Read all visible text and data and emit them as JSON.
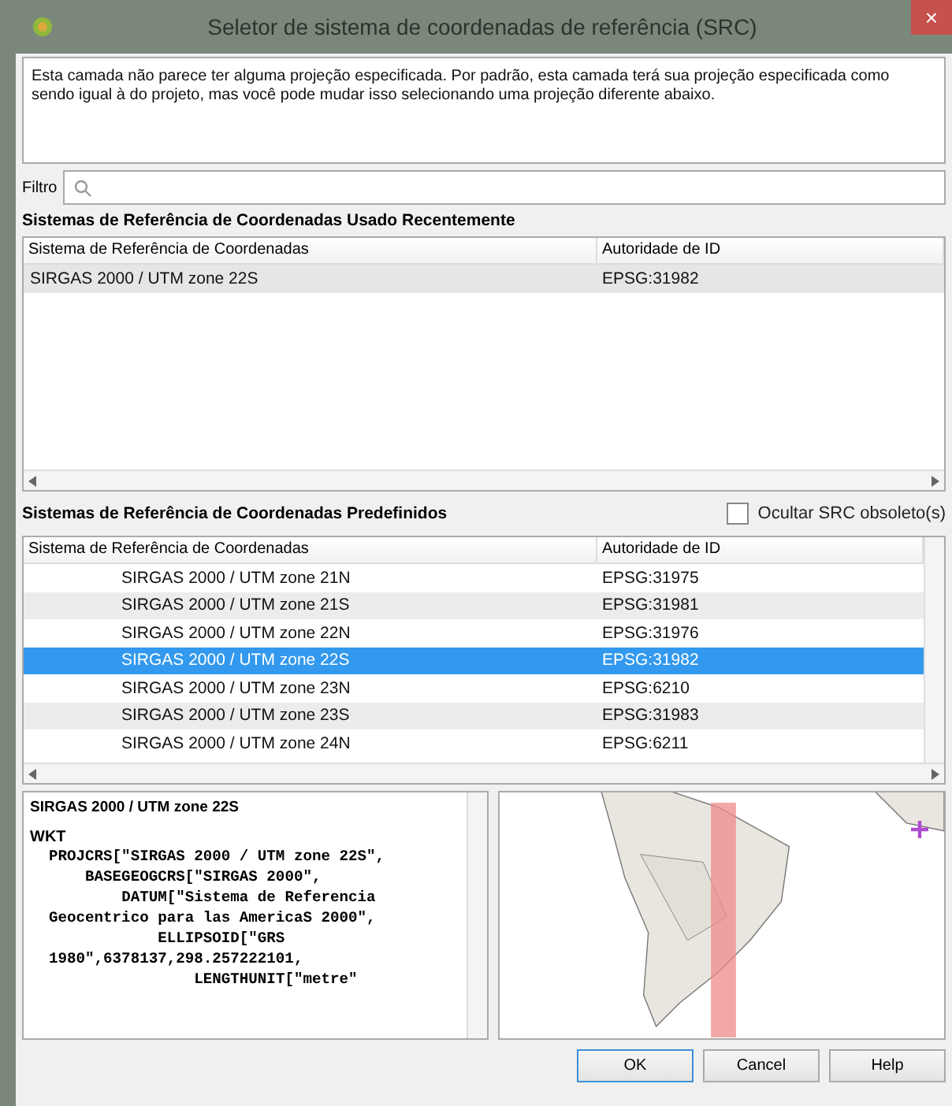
{
  "window": {
    "title": "Seletor de sistema de coordenadas de referência (SRC)",
    "close": "×"
  },
  "description": "Esta camada não parece ter alguma projeção especificada. Por padrão, esta camada terá sua projeção especificada como sendo igual à do projeto, mas você pode mudar isso selecionando uma projeção diferente abaixo.",
  "filter": {
    "label": "Filtro"
  },
  "recent": {
    "title": "Sistemas de Referência de Coordenadas Usado Recentemente",
    "columns": [
      "Sistema de Referência de Coordenadas",
      "Autoridade de ID"
    ],
    "rows": [
      {
        "name": "SIRGAS 2000 / UTM zone 22S",
        "id": "EPSG:31982",
        "selected": true
      }
    ]
  },
  "predefined": {
    "title": "Sistemas de Referência de Coordenadas Predefinidos",
    "hide_obsolete": {
      "label": "Ocultar SRC obsoleto(s)",
      "checked": false
    },
    "columns": [
      "Sistema de Referência de Coordenadas",
      "Autoridade de ID"
    ],
    "rows": [
      {
        "name": "SIRGAS 2000 / UTM zone 21N",
        "id": "EPSG:31975",
        "selected": false
      },
      {
        "name": "SIRGAS 2000 / UTM zone 21S",
        "id": "EPSG:31981",
        "selected": false
      },
      {
        "name": "SIRGAS 2000 / UTM zone 22N",
        "id": "EPSG:31976",
        "selected": false
      },
      {
        "name": "SIRGAS 2000 / UTM zone 22S",
        "id": "EPSG:31982",
        "selected": true
      },
      {
        "name": "SIRGAS 2000 / UTM zone 23N",
        "id": "EPSG:6210",
        "selected": false
      },
      {
        "name": "SIRGAS 2000 / UTM zone 23S",
        "id": "EPSG:31983",
        "selected": false
      },
      {
        "name": "SIRGAS 2000 / UTM zone 24N",
        "id": "EPSG:6211",
        "selected": false
      }
    ]
  },
  "details": {
    "name": "SIRGAS 2000 / UTM zone 22S",
    "heading": "WKT",
    "wkt": "PROJCRS[\"SIRGAS 2000 / UTM zone 22S\",\n    BASEGEOGCRS[\"SIRGAS 2000\",\n        DATUM[\"Sistema de Referencia Geocentrico para las AmericaS 2000\",\n            ELLIPSOID[\"GRS 1980\",6378137,298.257222101,\n                LENGTHUNIT[\"metre\""
  },
  "buttons": [
    "OK",
    "Cancel",
    "Help"
  ]
}
